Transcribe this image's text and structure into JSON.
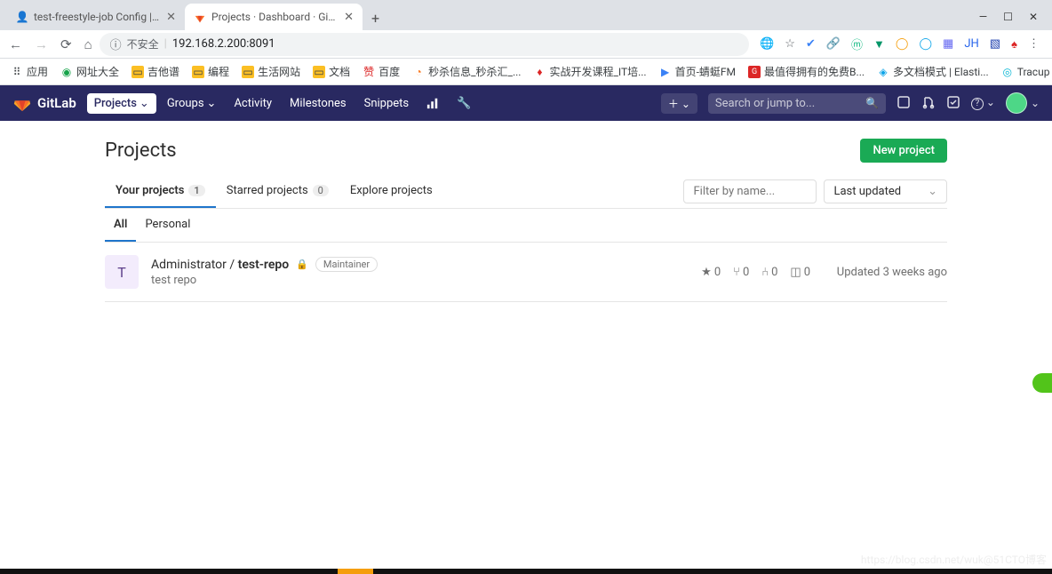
{
  "browser": {
    "tabs": [
      {
        "title": "test-freestyle-job Config |Jenk"
      },
      {
        "title": "Projects · Dashboard · GitLab"
      }
    ],
    "window_controls": {
      "min": "—",
      "max": "☐",
      "close": "✕"
    },
    "insecure_label": "不安全",
    "url": "192.168.2.200:8091",
    "bookmarks": [
      "应用",
      "网址大全",
      "吉他谱",
      "编程",
      "生活网站",
      "文档",
      "百度",
      "秒杀信息_秒杀汇_...",
      "实战开发课程_IT培...",
      "首页-蜻蜓FM",
      "最值得拥有的免费B...",
      "多文档模式 | Elasti...",
      "Tracup | 登录"
    ]
  },
  "gitlab": {
    "brand": "GitLab",
    "nav": {
      "projects": "Projects",
      "groups": "Groups",
      "activity": "Activity",
      "milestones": "Milestones",
      "snippets": "Snippets"
    },
    "plus_label": "＋",
    "search_placeholder": "Search or jump to...",
    "help_label": "?"
  },
  "page": {
    "title": "Projects",
    "new_project": "New project",
    "tabs": {
      "your": "Your projects",
      "your_count": "1",
      "starred": "Starred projects",
      "starred_count": "0",
      "explore": "Explore projects"
    },
    "filter_placeholder": "Filter by name...",
    "sort": "Last updated",
    "sub_tabs": {
      "all": "All",
      "personal": "Personal"
    }
  },
  "project": {
    "avatar_letter": "T",
    "namespace": "Administrator / ",
    "name": "test-repo",
    "role": "Maintainer",
    "description": "test repo",
    "stars": "0",
    "forks": "0",
    "mrs": "0",
    "issues": "0",
    "updated": "Updated 3 weeks ago"
  },
  "watermark": "https://blog.csdn.net/wuk@51CTO博客"
}
